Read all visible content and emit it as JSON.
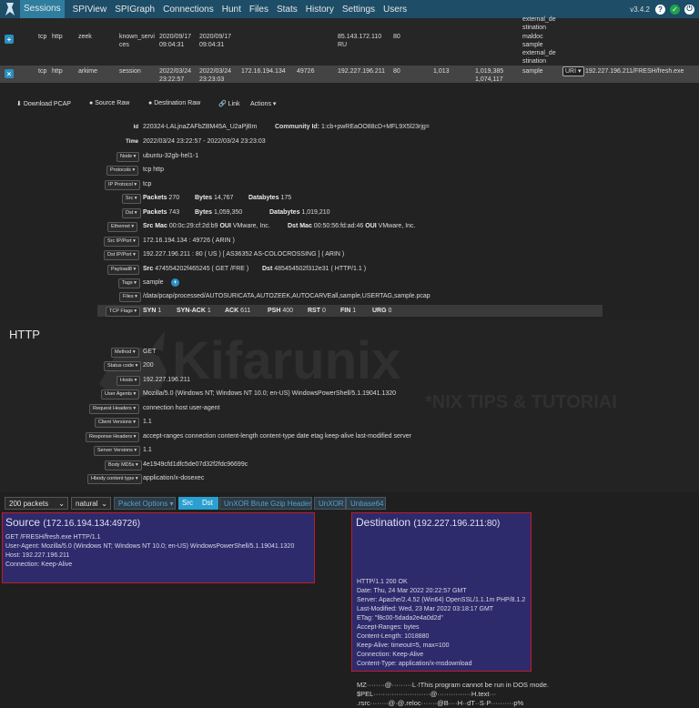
{
  "nav": {
    "items": [
      "Sessions",
      "SPIView",
      "SPIGraph",
      "Connections",
      "Hunt",
      "Files",
      "Stats",
      "History",
      "Settings",
      "Users"
    ],
    "version": "v3.4.2"
  },
  "sessions": {
    "top_cells": {
      "c1": "external_de",
      "c2": "stination"
    },
    "row1": {
      "toggle": "+",
      "proto": "tcp",
      "app": "http",
      "node": "zeek",
      "tags": [
        "known_servi",
        "ces"
      ],
      "start": [
        "2020/09/17",
        "09:04:31"
      ],
      "stop": [
        "2020/09/17",
        "09:04:31"
      ],
      "dst_ip": [
        "85.143.172.110",
        "RU"
      ],
      "dst_port": "80",
      "extra": [
        "maldoc",
        "sample",
        "external_de",
        "stination"
      ]
    },
    "row2": {
      "toggle": "×",
      "proto": "tcp",
      "app": "http",
      "node": "arkime",
      "tags": "session",
      "start": [
        "2022/03/24",
        "23:22:57"
      ],
      "stop": [
        "2022/03/24",
        "23:23:03"
      ],
      "src_ip": "172.16.194.134",
      "src_port": "49726",
      "dst_ip": [
        "192.227.196.211",
        "US"
      ],
      "dst_port": "80",
      "packets": "1,013",
      "bytes": [
        "1,019,385",
        "1,074,117"
      ],
      "tag": "sample",
      "uri_select": "URI",
      "uri": "192.227.196.211/FRESH/fresh.exe"
    }
  },
  "actions": {
    "download": "Download PCAP",
    "source": "Source Raw",
    "destination": "Destination Raw",
    "link": "Link",
    "actions": "Actions"
  },
  "detail": {
    "id_label": "Id",
    "id": "220324-LALjnaZAFbZBM45A_U2aPjBm",
    "community_label": "Community Id:",
    "community": "1:cb+pwREaOO88cD+MFL9X5l23rjg=",
    "time_label": "Time",
    "time": "2022/03/24 23:22:57  -  2022/03/24 23:23:03",
    "node_label": "Node",
    "node": "ubuntu-32gb-hel1-1",
    "protocols_label": "Protocols",
    "protocols": "tcp    http",
    "ipproto_label": "IP Protocol",
    "ipproto": "tcp",
    "src_label": "Src",
    "src_packets_k": "Packets",
    "src_packets": "270",
    "src_bytes_k": "Bytes",
    "src_bytes": "14,767",
    "src_databytes_k": "Databytes",
    "src_databytes": "175",
    "dst_label": "Dst",
    "dst_packets": "743",
    "dst_bytes": "1,059,350",
    "dst_databytes": "1,019,210",
    "ethernet_label": "Ethernet",
    "srcmac_k": "Src Mac",
    "srcmac": "00:0c:29:cf:2d:b9",
    "oui_k": "OUI",
    "srcoui": "VMware, Inc.",
    "dstmac_k": "Dst Mac",
    "dstmac": "00:50:56:fd:ad:46",
    "dstoui": "VMware, Inc.",
    "srcipport_label": "Src IP/Port",
    "srcipport": "172.16.194.134  : 49726  ( ARIN )",
    "dstipport_label": "Dst IP/Port",
    "dstipport": "192.227.196.211  : 80  ( US )  [ AS36352 AS-COLOCROSSING ]  ( ARIN )",
    "payload_label": "Payload8",
    "payload_src_k": "Src",
    "payload_src": "474554202f465245  ( GET /FRE )",
    "payload_dst_k": "Dst",
    "payload_dst": "485454502f312e31  ( HTTP/1.1 )",
    "tags_label": "Tags",
    "tags": "sample",
    "files_label": "Files",
    "files": "/data/pcap/processed/AUTOSURICATA,AUTOZEEK,AUTOCARVEall,sample,USERTAG,sample.pcap",
    "tcpflags_label": "TCP Flags",
    "flags": [
      {
        "k": "SYN",
        "v": "1"
      },
      {
        "k": "SYN-ACK",
        "v": "1"
      },
      {
        "k": "ACK",
        "v": "611"
      },
      {
        "k": "PSH",
        "v": "400"
      },
      {
        "k": "RST",
        "v": "0"
      },
      {
        "k": "FIN",
        "v": "1"
      },
      {
        "k": "URG",
        "v": "0"
      }
    ]
  },
  "http": {
    "title": "HTTP",
    "fields": [
      {
        "label": "Method",
        "value": "GET"
      },
      {
        "label": "Status code",
        "value": "200"
      },
      {
        "label": "Hosts",
        "value": "192.227.196.211"
      },
      {
        "label": "User Agents",
        "value": "Mozilla/5.0 (Windows NT; Windows NT 10.0; en-US) WindowsPowerShell/5.1.19041.1320"
      },
      {
        "label": "Request Headers",
        "value": "connection    host    user-agent"
      },
      {
        "label": "Client Versions",
        "value": "1.1"
      },
      {
        "label": "Response Headers",
        "value": "accept-ranges    connection    content-length    content-type    date    etag    keep-alive    last-modified    server"
      },
      {
        "label": "Server Versions",
        "value": "1.1"
      },
      {
        "label": "Body MD5s",
        "value": "4e1949cfd1dfc5de07d32f2fdc96699c"
      },
      {
        "label": "Hbody content type",
        "value": "application/x-dosexec"
      }
    ],
    "watermark_brand": "Kifarunix",
    "watermark_tag": "*NIX TIPS & TUTORIALS"
  },
  "toolbar": {
    "packets": "200 packets",
    "mode": "natural",
    "options": "Packet Options",
    "src": "Src",
    "dst": "Dst",
    "unxor_brute": "UnXOR Brute Gzip Header",
    "unxor": "UnXOR",
    "unbase64": "Unbase64"
  },
  "source_pane": {
    "title": "Source",
    "addr": "(172.16.194.134:49726)",
    "lines": [
      "GET /FRESH/fresh.exe HTTP/1.1",
      "User-Agent: Mozilla/5.0 (Windows NT; Windows NT 10.0; en-US) WindowsPowerShell/5.1.19041.1320",
      "Host: 192.227.196.211",
      "Connection: Keep-Alive"
    ]
  },
  "dest_pane": {
    "title": "Destination",
    "addr": "(192.227.196.211:80)",
    "lines": [
      "HTTP/1.1 200 OK",
      "Date: Thu, 24 Mar 2022 20:22:57 GMT",
      "Server: Apache/2.4.52 (Win64) OpenSSL/1.1.1m PHP/8.1.2",
      "Last-Modified: Wed, 23 Mar 2022 03:18:17 GMT",
      "ETag: \"f8c00-5dada2e4a0d2d\"",
      "Accept-Ranges: bytes",
      "Content-Length: 1018880",
      "Keep-Alive: timeout=5, max=100",
      "Connection: Keep-Alive",
      "Content-Type: application/x-msdownload"
    ]
  },
  "binary": {
    "lines": [
      "MZ········@·········L·!This program cannot be run in DOS mode.",
      "$PEL·························@···············H.text···",
      ".rsrc········@·@.reloc·······@B····H··dT··S·P··········p%"
    ]
  }
}
